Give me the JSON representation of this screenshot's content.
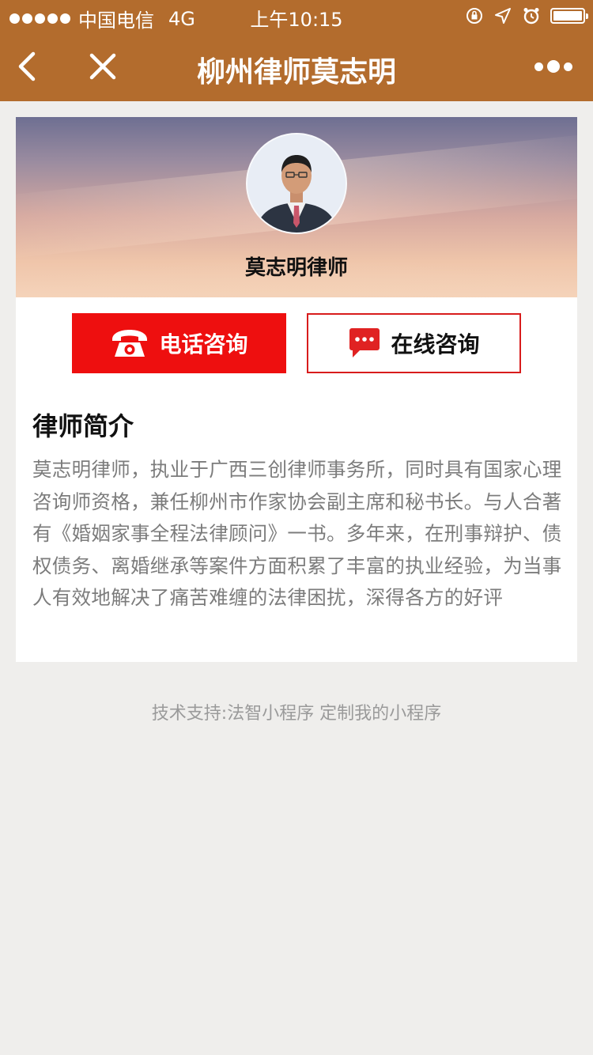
{
  "status_bar": {
    "carrier": "中国电信",
    "network": "4G",
    "time": "上午10:15"
  },
  "nav": {
    "title": "柳州律师莫志明"
  },
  "profile": {
    "name": "莫志明律师"
  },
  "buttons": {
    "phone_label": "电话咨询",
    "online_label": "在线咨询"
  },
  "intro": {
    "title": "律师简介",
    "text": "莫志明律师，执业于广西三创律师事务所，同时具有国家心理咨询师资格，兼任柳州市作家协会副主席和秘书长。与人合著有《婚姻家事全程法律顾问》一书。多年来，在刑事辩护、债权债务、离婚继承等案件方面积累了丰富的执业经验，为当事人有效地解决了痛苦难缠的法律困扰，深得各方的好评"
  },
  "footer": {
    "text": "技术支持:法智小程序 定制我的小程序"
  },
  "colors": {
    "brand": "#b36c2d",
    "phone_button": "#ee0f0f",
    "online_border": "#d81c1c"
  }
}
